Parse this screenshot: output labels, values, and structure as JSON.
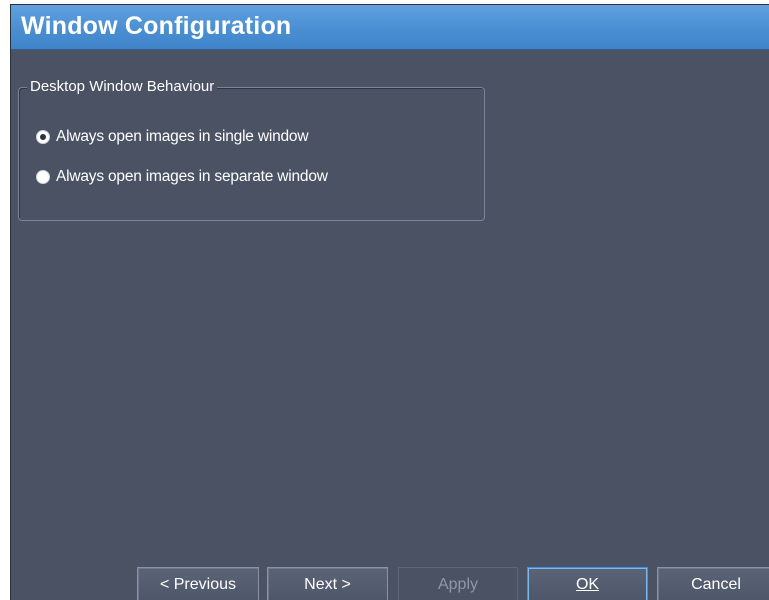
{
  "window": {
    "title": "Window Configuration"
  },
  "group": {
    "label": "Desktop Window Behaviour",
    "options": [
      {
        "label": "Always open images in single window",
        "selected": true
      },
      {
        "label": "Always open images in separate window",
        "selected": false
      }
    ]
  },
  "buttons": {
    "previous": "< Previous",
    "next": "Next >",
    "apply": "Apply",
    "ok": "OK",
    "cancel": "Cancel"
  },
  "colors": {
    "title_bar": "#4b8fd3",
    "panel_background": "#4a5264",
    "text": "#ffffff",
    "focus_border": "#3e8fe0"
  }
}
